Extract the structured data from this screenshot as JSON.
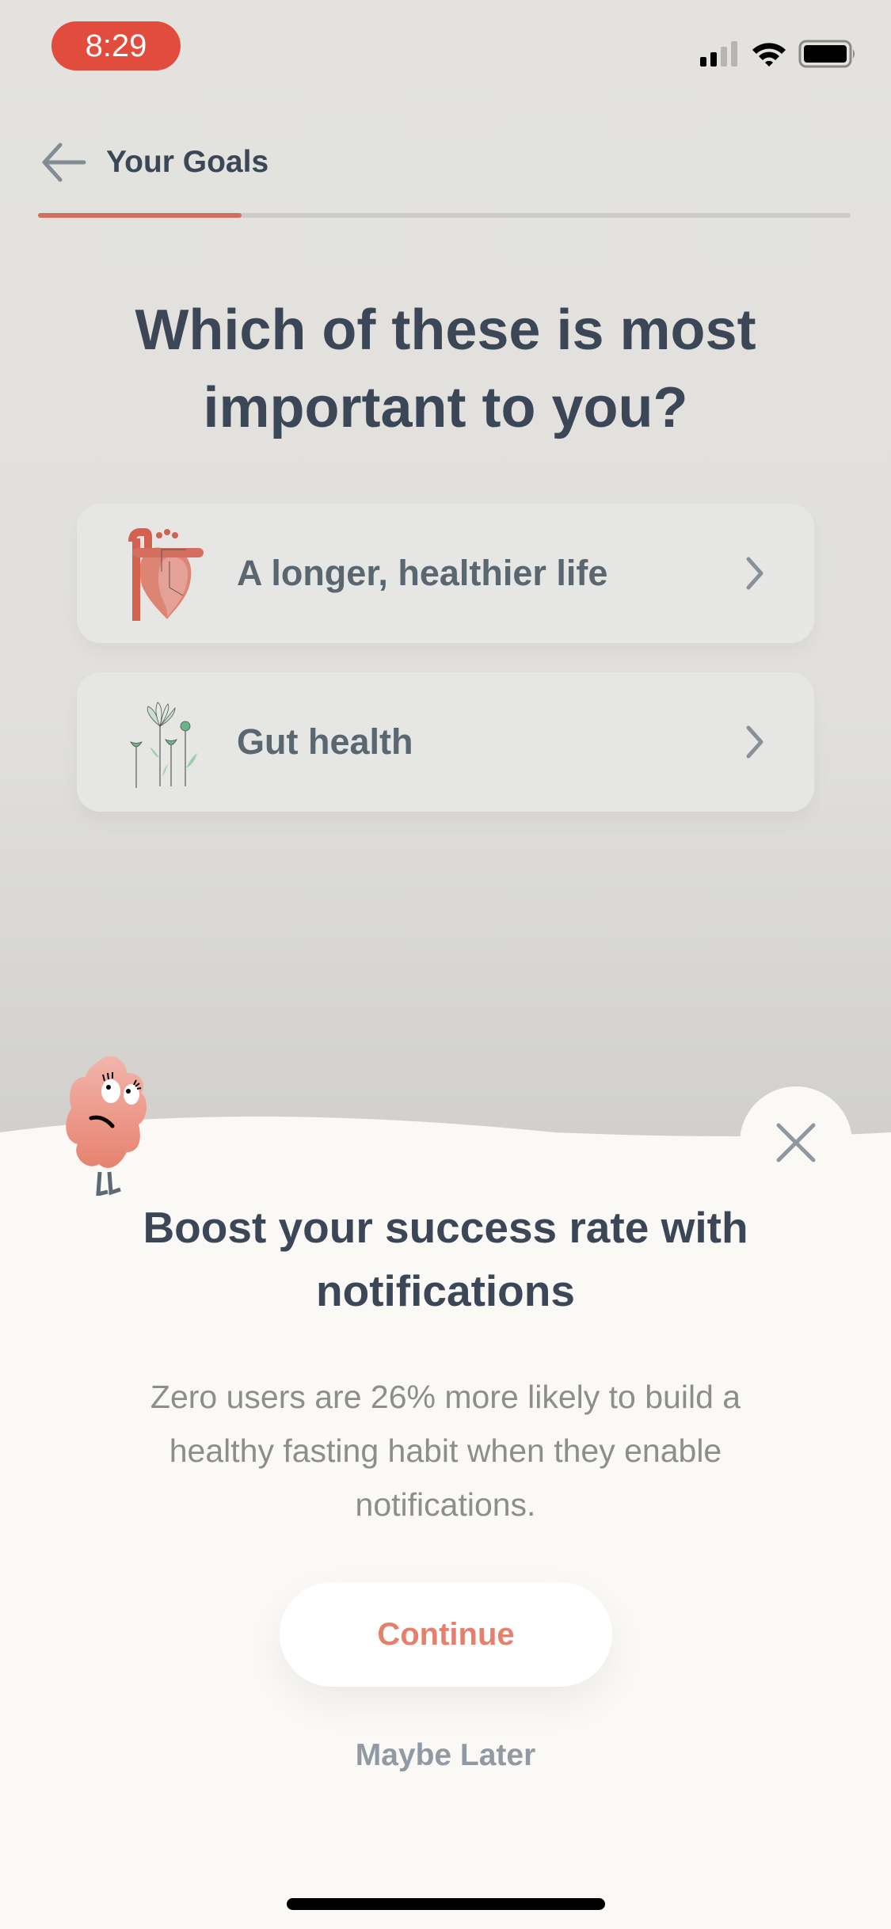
{
  "status_bar": {
    "time": "8:29",
    "icons": [
      "cellular-signal-icon",
      "wifi-icon",
      "battery-icon"
    ]
  },
  "header": {
    "back_icon": "arrow-left-icon",
    "title": "Your Goals",
    "progress_fraction": 0.25,
    "colors": {
      "progress_fill": "#d2705f",
      "progress_track": "#cdccc9"
    }
  },
  "question": {
    "line1": "Which of these is most",
    "line2": "important to you?"
  },
  "options": [
    {
      "label": "A longer, healthier life",
      "icon": "heart-anatomy-icon",
      "chevron": "chevron-right-icon"
    },
    {
      "label": "Gut health",
      "icon": "flowers-sprouts-icon",
      "chevron": "chevron-right-icon"
    }
  ],
  "sheet": {
    "mascot": "worried-blob-mascot",
    "close_icon": "close-x-icon",
    "title_line1": "Boost your success rate with",
    "title_line2": "notifications",
    "body_line1": "Zero users are 26% more likely to build a",
    "body_line2": "healthy fasting habit when they enable",
    "body_line3": "notifications.",
    "continue_label": "Continue",
    "later_label": "Maybe Later",
    "colors": {
      "accent": "#e5806d",
      "title": "#3b4656",
      "body": "#8d8d8d",
      "secondary": "#9199a2",
      "sheet_bg": "#faf9f6"
    }
  }
}
